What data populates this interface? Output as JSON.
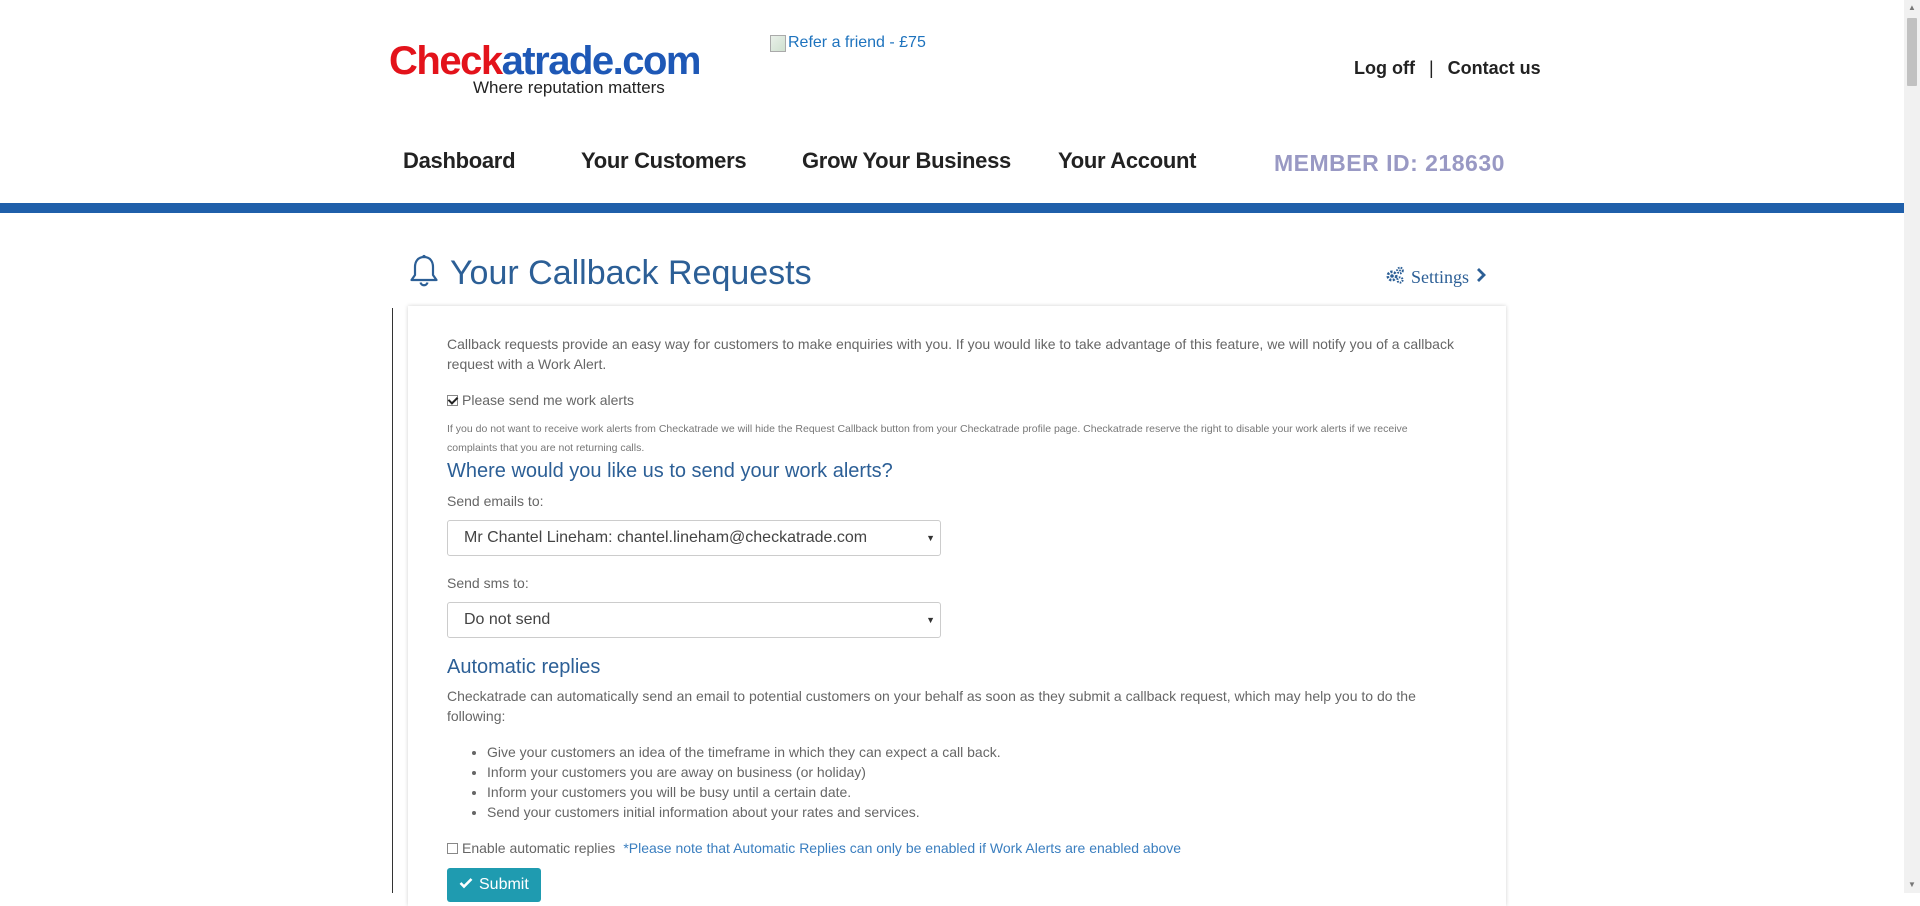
{
  "header": {
    "logo_part1": "Chec",
    "logo_k": "k",
    "logo_part2": "atrade.com",
    "tagline": "Where reputation matters",
    "refer_alt": "Refer a friend - £75",
    "log_off": "Log off",
    "separator": "|",
    "contact_us": "Contact us"
  },
  "nav": {
    "items": [
      "Dashboard",
      "Your Customers",
      "Grow Your Business",
      "Your Account"
    ],
    "member_id": "MEMBER ID: 218630"
  },
  "page": {
    "title": "Your Callback Requests",
    "settings_label": "Settings"
  },
  "intro": "Callback requests provide an easy way for customers to make enquiries with you. If you would like to take advantage of this feature, we will notify you of a callback request with a Work Alert.",
  "work_alerts": {
    "checkbox_label": "Please send me work alerts",
    "checked": true,
    "disclaimer": "If you do not want to receive work alerts from Checkatrade we will hide the Request Callback button from your Checkatrade profile page. Checkatrade reserve the right to disable your work alerts if we receive complaints that you are not returning calls."
  },
  "send_section": {
    "heading": "Where would you like us to send your work alerts?",
    "email_label": "Send emails to:",
    "email_value": "Mr Chantel Lineham: chantel.lineham@checkatrade.com",
    "sms_label": "Send sms to:",
    "sms_value": "Do not send"
  },
  "auto_replies": {
    "heading": "Automatic replies",
    "description": "Checkatrade can automatically send an email to potential customers on your behalf as soon as they submit a callback request, which may help you to do the following:",
    "bullets": [
      "Give your customers an idea of the timeframe in which they can expect a call back.",
      "Inform your customers you are away on business (or holiday)",
      "Inform your customers you will be busy until a certain date.",
      "Send your customers initial information about your rates and services."
    ],
    "enable_label": "Enable automatic replies",
    "enabled": false,
    "note": "*Please note that Automatic Replies can only be enabled if Work Alerts are enabled above"
  },
  "submit_label": "Submit",
  "colors": {
    "brand_blue": "#1f5faa",
    "heading_blue": "#2c5f96",
    "submit_teal": "#1f9bb0",
    "member_id": "#9999c4",
    "logo_red": "#e3131b"
  }
}
